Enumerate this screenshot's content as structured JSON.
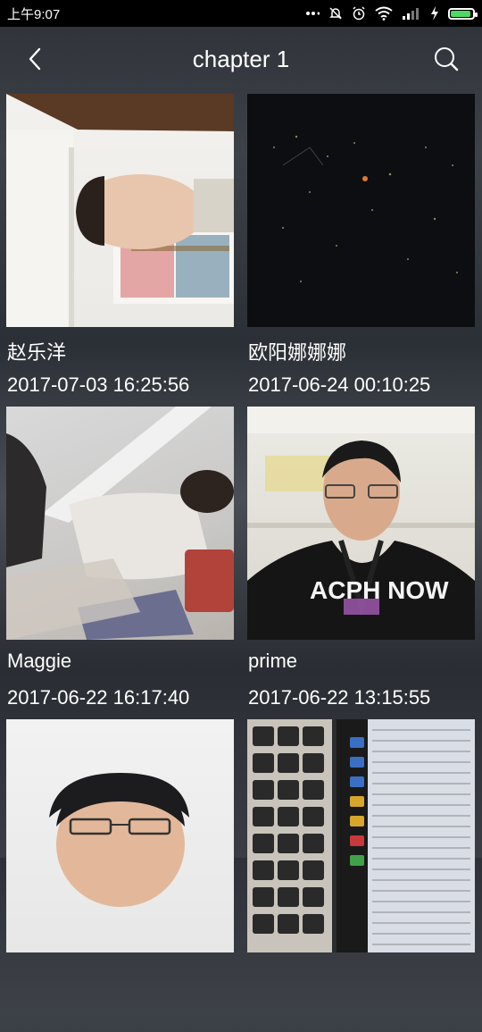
{
  "status_bar": {
    "time": "上午9:07"
  },
  "header": {
    "title": "chapter 1",
    "back_icon": "chevron-left-icon",
    "search_icon": "search-icon"
  },
  "items": [
    {
      "name": "赵乐洋",
      "date": "2017-07-03 16:25:56"
    },
    {
      "name": "欧阳娜娜娜",
      "date": "2017-06-24 00:10:25"
    },
    {
      "name": "Maggie",
      "date": "2017-06-22 16:17:40"
    },
    {
      "name": "prime",
      "date": "2017-06-22 13:15:55"
    },
    {
      "name": "",
      "date": ""
    },
    {
      "name": "",
      "date": ""
    }
  ],
  "colors": {
    "status_bar_bg": "#000000",
    "battery": "#4cd964"
  }
}
